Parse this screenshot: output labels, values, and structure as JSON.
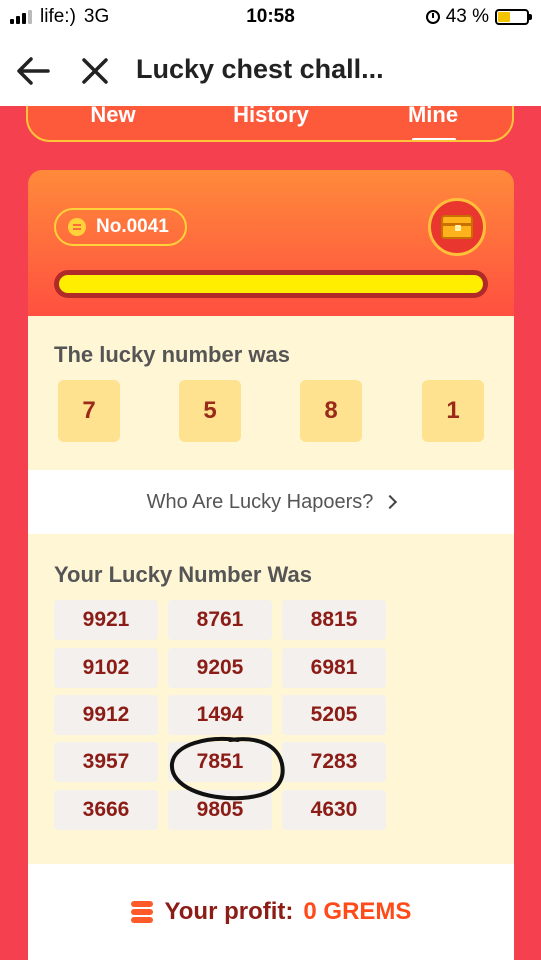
{
  "status_bar": {
    "carrier": "life:)",
    "network": "3G",
    "time": "10:58",
    "battery_percent": "43 %"
  },
  "nav": {
    "title": "Lucky chest chall..."
  },
  "tabs": [
    {
      "label": "New"
    },
    {
      "label": "History"
    },
    {
      "label": "Mine"
    }
  ],
  "card": {
    "badge": "No.0041",
    "progress": 1.0,
    "lucky_title": "The lucky number was",
    "lucky_digits": [
      "7",
      "5",
      "8",
      "1"
    ],
    "happers_link": "Who Are Lucky Hapoers?",
    "your_title": "Your Lucky Number Was",
    "your_numbers": [
      [
        "9921",
        "8761",
        "8815"
      ],
      [
        "9102",
        "9205",
        "6981"
      ],
      [
        "9912",
        "1494",
        "5205"
      ],
      [
        "3957",
        "7851",
        "7283"
      ],
      [
        "3666",
        "9805",
        "4630"
      ]
    ],
    "profit_label": "Your profit:",
    "profit_value": "0 GREMS"
  },
  "colors": {
    "background": "#f5414f",
    "accent": "#ffee00",
    "number_text": "#8c1c16"
  }
}
